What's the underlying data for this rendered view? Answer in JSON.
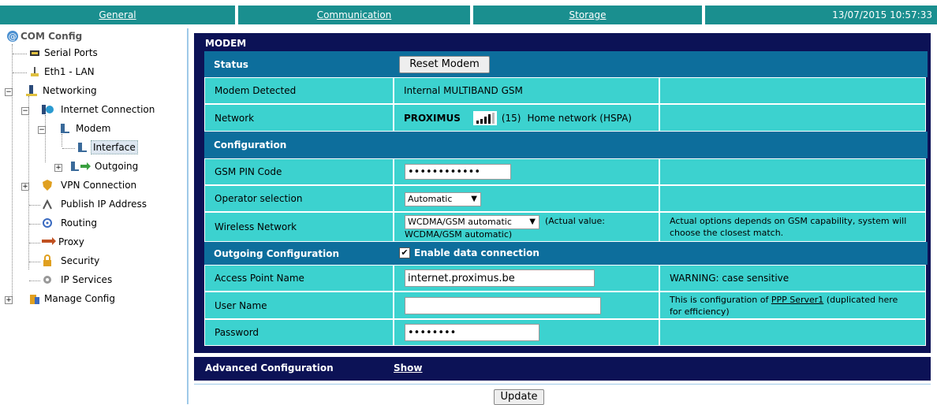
{
  "tabs": [
    "General",
    "Communication",
    "Storage"
  ],
  "datetime": "13/07/2015 10:57:33",
  "sidebar": {
    "root": "COM Config",
    "serial_ports": "Serial Ports",
    "eth1": "Eth1 - LAN",
    "networking": "Networking",
    "internet_connection": "Internet Connection",
    "modem": "Modem",
    "interface": "Interface",
    "outgoing": "Outgoing",
    "vpn": "VPN Connection",
    "publish_ip": "Publish IP Address",
    "routing": "Routing",
    "proxy": "Proxy",
    "security": "Security",
    "ip_services": "IP Services",
    "manage_config": "Manage Config"
  },
  "panel": {
    "title": "MODEM",
    "status_label": "Status",
    "reset_button": "Reset Modem",
    "modem_detected_label": "Modem Detected",
    "modem_detected_value": "Internal MULTIBAND GSM",
    "network_label": "Network",
    "network_operator": "PROXIMUS",
    "network_signal": "(15)",
    "network_status": "Home network (HSPA)",
    "configuration_label": "Configuration",
    "gsm_pin_label": "GSM PIN Code",
    "gsm_pin_value": "••••••••••••",
    "operator_selection_label": "Operator selection",
    "operator_selection_value": "Automatic",
    "wireless_network_label": "Wireless Network",
    "wireless_network_value": "WCDMA/GSM automatic",
    "wireless_actual_1": "(Actual value:",
    "wireless_actual_2": "WCDMA/GSM automatic)",
    "wireless_note_1": "Actual options depends on GSM capability, system will",
    "wireless_note_2": "choose the closest match.",
    "outgoing_label": "Outgoing Configuration",
    "enable_data_label": "Enable data connection",
    "apn_label": "Access Point Name",
    "apn_value": "internet.proximus.be",
    "apn_note": "WARNING: case sensitive",
    "username_label": "User Name",
    "username_value": "",
    "username_note_1": "This is configuration of",
    "username_note_link": "PPP Server1",
    "username_note_2": "(duplicated here",
    "username_note_3": "for efficiency)",
    "password_label": "Password",
    "password_value": "••••••••"
  },
  "advanced": {
    "label": "Advanced Configuration",
    "show": "Show"
  },
  "update_button": "Update",
  "colors": {
    "tab": "#1a8f8f",
    "panel": "#0c1256",
    "section": "#0d6e9c",
    "cell": "#3cd2cf"
  }
}
